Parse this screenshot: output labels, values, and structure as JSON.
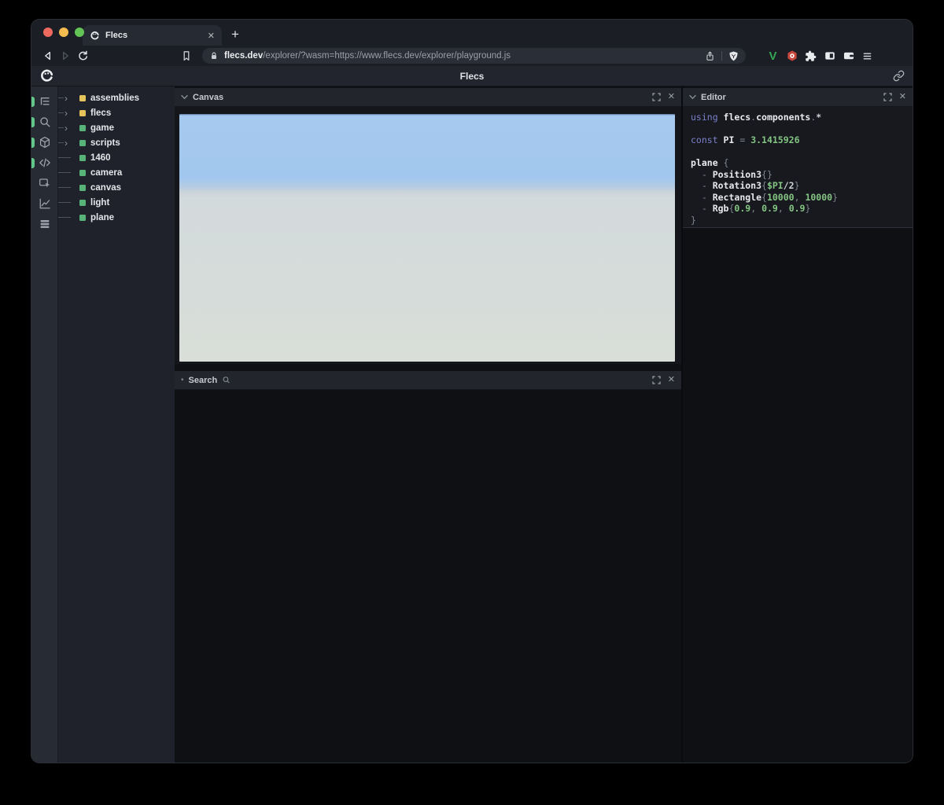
{
  "browser": {
    "tab_title": "Flecs",
    "tab_close_label": "✕",
    "new_tab_label": "+",
    "url_domain": "flecs.dev",
    "url_path": "/explorer/?wasm=https://www.flecs.dev/explorer/playground.js",
    "chrome_icons": [
      "back-icon",
      "forward-icon",
      "reload-icon",
      "bookmark-icon",
      "lock-icon",
      "share-icon",
      "brave-shield-icon",
      "vimium-icon",
      "extension-red-icon",
      "extensions-puzzle-icon",
      "sidebar-toggle-icon",
      "wallet-icon",
      "menu-icon"
    ],
    "traffic_lights": {
      "close": "#ee6a5f",
      "minimize": "#f5bd4f",
      "zoom": "#62c454"
    }
  },
  "header": {
    "title": "Flecs",
    "logo": "flecs-logo",
    "link_icon": "link-icon"
  },
  "sidebar": {
    "items": [
      {
        "icon": "entity-tree-icon",
        "active": true
      },
      {
        "icon": "search-icon",
        "active": true
      },
      {
        "icon": "cube-icon",
        "active": true
      },
      {
        "icon": "code-icon",
        "active": true
      },
      {
        "icon": "inspector-icon",
        "active": false
      },
      {
        "icon": "stats-chart-icon",
        "active": false
      },
      {
        "icon": "tables-icon",
        "active": false
      }
    ]
  },
  "tree": {
    "items": [
      {
        "label": "assemblies",
        "dot": "yellow",
        "expandable": true
      },
      {
        "label": "flecs",
        "dot": "yellow",
        "expandable": true
      },
      {
        "label": "game",
        "dot": "green",
        "expandable": true
      },
      {
        "label": "scripts",
        "dot": "green",
        "expandable": true
      },
      {
        "label": "1460",
        "dot": "green",
        "expandable": false
      },
      {
        "label": "camera",
        "dot": "green",
        "expandable": false
      },
      {
        "label": "canvas",
        "dot": "green",
        "expandable": false
      },
      {
        "label": "light",
        "dot": "green",
        "expandable": false
      },
      {
        "label": "plane",
        "dot": "green",
        "expandable": false
      }
    ]
  },
  "panels": {
    "canvas": {
      "title": "Canvas"
    },
    "search": {
      "title": "Search"
    },
    "editor": {
      "title": "Editor",
      "code": [
        [
          [
            "kw",
            "using "
          ],
          [
            "id",
            "flecs"
          ],
          [
            "pu",
            "."
          ],
          [
            "id",
            "components"
          ],
          [
            "pu",
            "."
          ],
          [
            "plain",
            "*"
          ]
        ],
        [],
        [
          [
            "kw",
            "const "
          ],
          [
            "id",
            "PI"
          ],
          [
            "pu",
            " = "
          ],
          [
            "num",
            "3.1415926"
          ]
        ],
        [],
        [
          [
            "id",
            "plane"
          ],
          [
            "pu",
            " {"
          ]
        ],
        [
          [
            "pu",
            "  - "
          ],
          [
            "id",
            "Position3"
          ],
          [
            "pu",
            "{}"
          ]
        ],
        [
          [
            "pu",
            "  - "
          ],
          [
            "id",
            "Rotation3"
          ],
          [
            "pu",
            "{"
          ],
          [
            "num",
            "$PI"
          ],
          [
            "plain",
            "/2"
          ],
          [
            "pu",
            "}"
          ]
        ],
        [
          [
            "pu",
            "  - "
          ],
          [
            "id",
            "Rectangle"
          ],
          [
            "pu",
            "{"
          ],
          [
            "num",
            "10000"
          ],
          [
            "pu",
            ", "
          ],
          [
            "num",
            "10000"
          ],
          [
            "pu",
            "}"
          ]
        ],
        [
          [
            "pu",
            "  - "
          ],
          [
            "id",
            "Rgb"
          ],
          [
            "pu",
            "{"
          ],
          [
            "num",
            "0.9"
          ],
          [
            "pu",
            ", "
          ],
          [
            "num",
            "0.9"
          ],
          [
            "pu",
            ", "
          ],
          [
            "num",
            "0.9"
          ],
          [
            "pu",
            "}"
          ]
        ],
        [
          [
            "pu",
            "}"
          ]
        ]
      ]
    }
  },
  "colors": {
    "yellow": "#e5c35b",
    "green": "#57b377",
    "active_pill": "#63c78c",
    "sky": "#a2c7ee",
    "ground": "#d8ddd8",
    "keyword": "#7b80c9",
    "number": "#84c583"
  }
}
